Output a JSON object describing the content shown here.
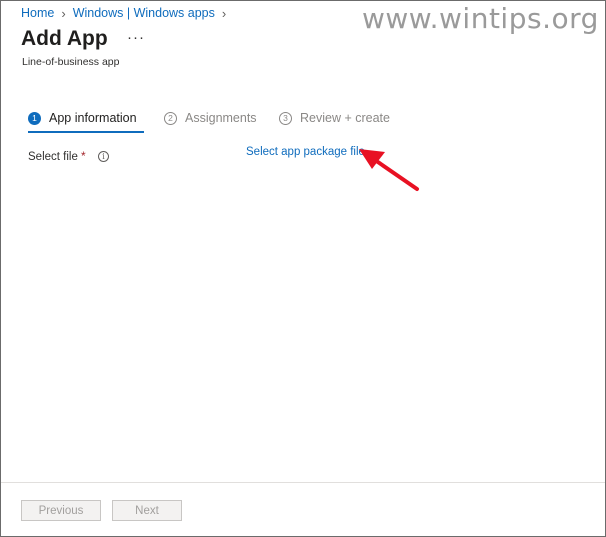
{
  "breadcrumb": {
    "items": [
      "Home",
      "Windows | Windows apps"
    ],
    "separator": "›"
  },
  "watermark": "www.wintips.org",
  "page": {
    "title": "Add App",
    "more": "···",
    "subtitle": "Line-of-business app"
  },
  "steps": [
    {
      "number": "1",
      "label": "App information",
      "state": "active"
    },
    {
      "number": "2",
      "label": "Assignments",
      "state": "inactive"
    },
    {
      "number": "3",
      "label": "Review + create",
      "state": "inactive"
    }
  ],
  "form": {
    "select_file_label": "Select file",
    "required_mark": "*",
    "info_glyph": "i",
    "select_link": "Select app package file"
  },
  "footer": {
    "previous": "Previous",
    "next": "Next"
  },
  "colors": {
    "accent": "#0f6cbd",
    "annotation_arrow": "#e81123",
    "required": "#a4262c"
  }
}
